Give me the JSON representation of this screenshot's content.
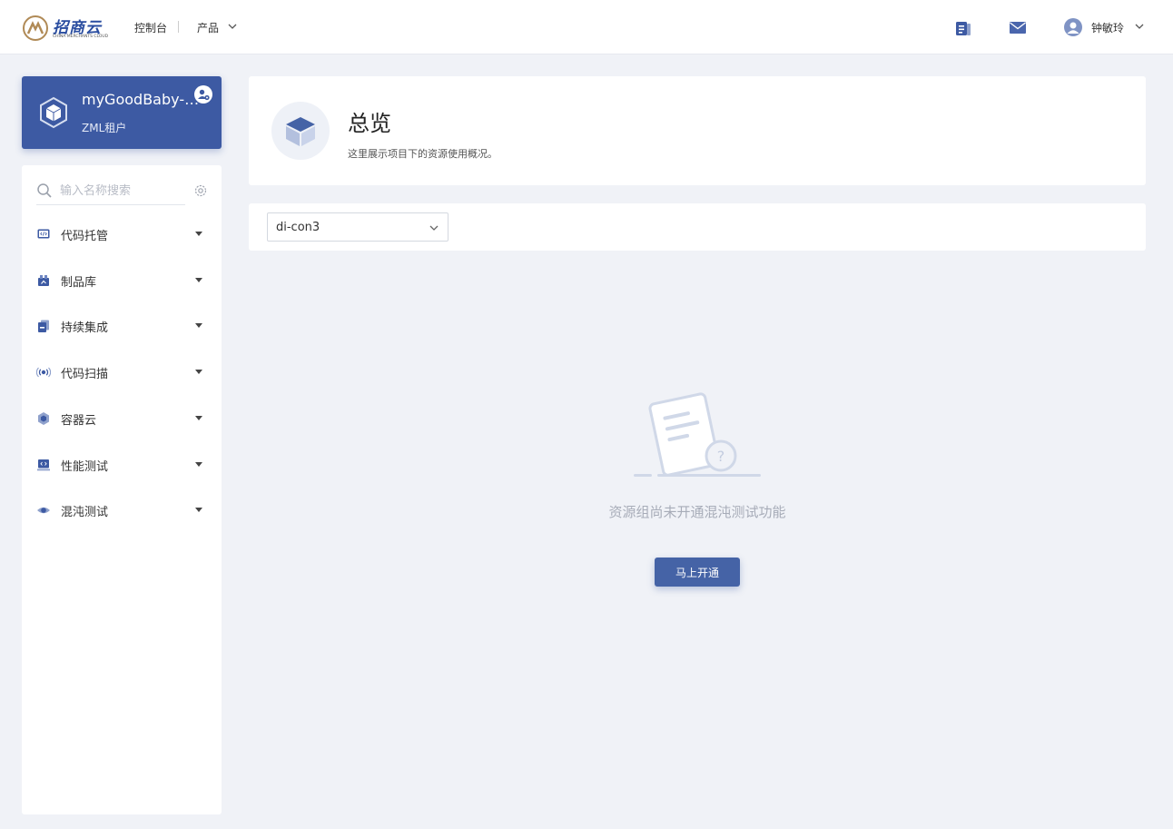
{
  "header": {
    "logo_text": "招商云",
    "logo_sub": "CHINA MERCHANTS CLOUD",
    "nav_console": "控制台",
    "nav_product": "产品",
    "doc_icon": "document-icon",
    "mail_icon": "mail-icon",
    "username": "钟敏玲"
  },
  "project": {
    "name": "myGoodBaby-z...",
    "tenant": "ZML租户"
  },
  "sidebar": {
    "search_placeholder": "输入名称搜索",
    "items": [
      {
        "label": "代码托管",
        "icon": "code-hosting-icon"
      },
      {
        "label": "制品库",
        "icon": "artifact-repo-icon"
      },
      {
        "label": "持续集成",
        "icon": "continuous-integration-icon"
      },
      {
        "label": "代码扫描",
        "icon": "code-scan-icon"
      },
      {
        "label": "容器云",
        "icon": "container-cloud-icon"
      },
      {
        "label": "性能测试",
        "icon": "performance-test-icon"
      },
      {
        "label": "混沌测试",
        "icon": "chaos-test-icon"
      }
    ]
  },
  "overview": {
    "title": "总览",
    "description": "这里展示项目下的资源使用概况。"
  },
  "filter": {
    "selected": "di-con3"
  },
  "empty": {
    "message": "资源组尚未开通混沌测试功能",
    "button": "马上开通"
  },
  "colors": {
    "primary": "#3d5aa3",
    "button": "#4563a6",
    "background": "#f0f2f7"
  }
}
